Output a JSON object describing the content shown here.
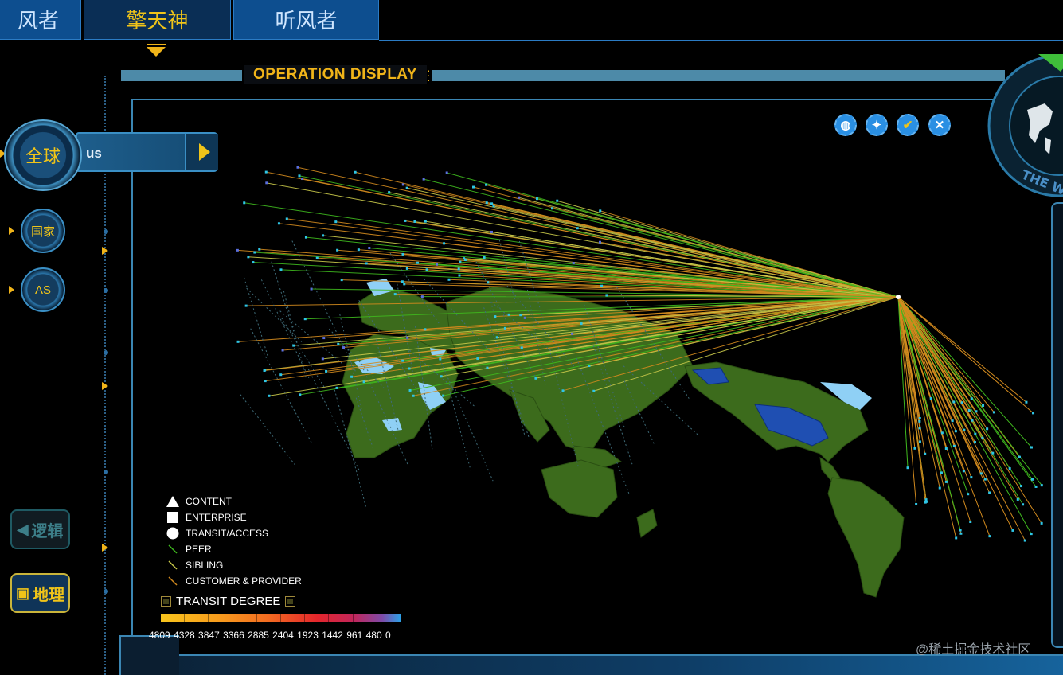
{
  "tabs": [
    {
      "label": "风者"
    },
    {
      "label": "擎天神"
    },
    {
      "label": "听风者"
    }
  ],
  "header": {
    "title": "OPERATION DISPLAY"
  },
  "nav": {
    "global": "全球",
    "selected_region": "us",
    "country": "国家",
    "as": "AS"
  },
  "modes": {
    "logic": "逻辑",
    "geo": "地理"
  },
  "map_controls": [
    {
      "icon": "globe-icon"
    },
    {
      "icon": "china-map-icon"
    },
    {
      "icon": "check-icon"
    },
    {
      "icon": "close-icon"
    }
  ],
  "legend": {
    "content": "CONTENT",
    "enterprise": "ENTERPRISE",
    "transit": "TRANSIT/ACCESS",
    "peer": "PEER",
    "sibling": "SIBLING",
    "customer": "CUSTOMER & PROVIDER"
  },
  "transit_degree": {
    "title": "TRANSIT DEGREE",
    "labels": "4809 4328 3847 3366 2885 2404 1923 1442 961   480   0"
  },
  "globe_badge": {
    "text": "THE W"
  },
  "colors": {
    "peer": "#3fb81e",
    "sibling": "#c8c84a",
    "customer": "#d28a1e",
    "land": "#3c6b1c",
    "highlight": "#1f4fb2"
  },
  "watermark": "@稀土掘金技术社区"
}
